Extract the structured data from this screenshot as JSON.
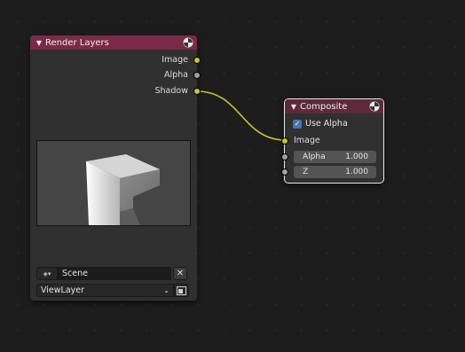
{
  "colors": {
    "background": "#1d1d1d",
    "node_body": "#303030",
    "render_layers_header": "#7a2a46",
    "composite_header": "#5b2a3b",
    "socket_color": "#c7c729",
    "socket_float": "#a1a1a1",
    "link": "#c7c729",
    "checkbox": "#4772b3"
  },
  "render_layers": {
    "title": "Render Layers",
    "header_icon": "render-layers-node-icon",
    "outputs": [
      {
        "label": "Image"
      },
      {
        "label": "Alpha"
      },
      {
        "label": "Shadow"
      }
    ],
    "scene": {
      "icon": "scene-icon",
      "value": "Scene",
      "clear": "✕"
    },
    "view_layer": {
      "value": "ViewLayer",
      "render_icon": "render-view-layer-icon"
    }
  },
  "composite": {
    "title": "Composite",
    "header_icon": "composite-node-icon",
    "use_alpha_label": "Use Alpha",
    "use_alpha_checked": true,
    "inputs": [
      {
        "label": "Image"
      },
      {
        "label": "Alpha",
        "value": "1.000"
      },
      {
        "label": "Z",
        "value": "1.000"
      }
    ]
  }
}
